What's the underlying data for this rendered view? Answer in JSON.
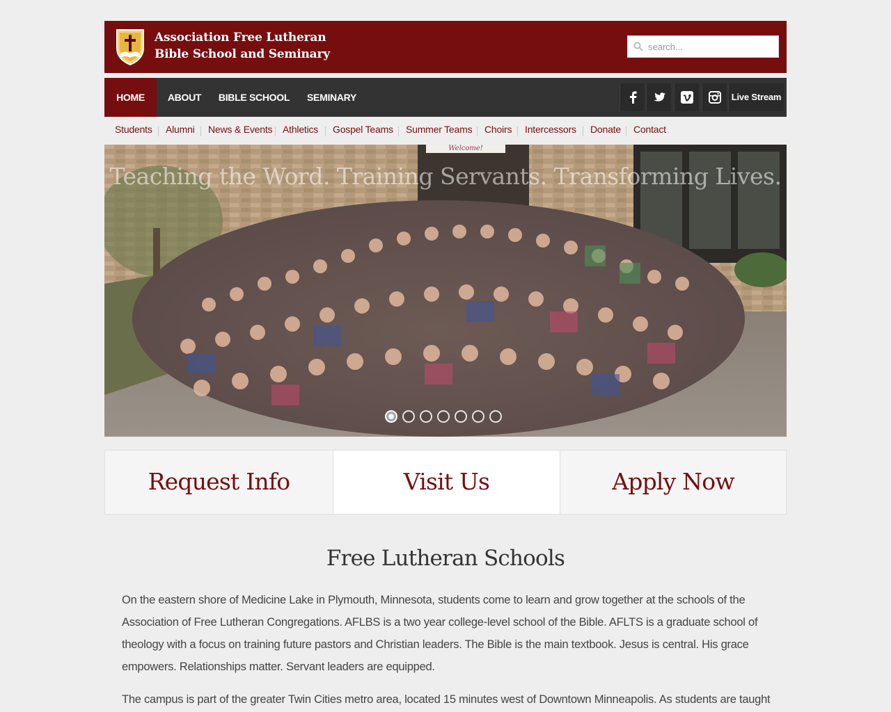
{
  "header": {
    "title_line1": "Association Free Lutheran",
    "title_line2": "Bible School and Seminary",
    "search_placeholder": "search...",
    "brand_color": "#760e10"
  },
  "mainnav": {
    "items": [
      {
        "label": "HOME",
        "active": true
      },
      {
        "label": "ABOUT"
      },
      {
        "label": "BIBLE SCHOOL"
      },
      {
        "label": "SEMINARY"
      }
    ],
    "social": [
      "facebook-icon",
      "twitter-icon",
      "vimeo-icon",
      "instagram-icon"
    ],
    "live_stream": "Live Stream"
  },
  "subnav": {
    "items": [
      "Students",
      "Alumni",
      "News & Events",
      "Athletics",
      "Gospel Teams",
      "Summer Teams",
      "Choirs",
      "Intercessors",
      "Donate",
      "Contact"
    ]
  },
  "hero": {
    "tagline": "Teaching the Word. Training Servants. Transforming Lives.",
    "sign_text": "Welcome!",
    "slide_count": 7,
    "active_slide": 1
  },
  "cta": {
    "request": "Request Info",
    "visit": "Visit Us",
    "apply": "Apply Now"
  },
  "content": {
    "heading": "Free Lutheran Schools",
    "para1": "On the eastern shore of Medicine Lake in Plymouth, Minnesota, students come to learn and grow together at the schools of the Association of Free Lutheran Congregations. AFLBS is a two year college-level school of the Bible. AFLTS is a graduate school of theology with a focus on training future pastors and Christian leaders. The Bible is the main textbook. Jesus is central. His grace empowers. Relationships matter. Servant leaders are equipped.",
    "para2": "The campus is part of the greater Twin Cities metro area, located 15 minutes west of Downtown Minneapolis. As students are taught"
  }
}
